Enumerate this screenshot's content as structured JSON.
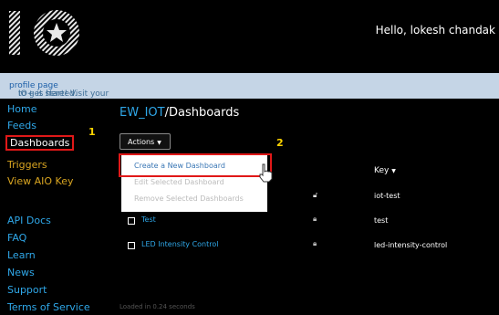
{
  "header": {
    "greeting": "Hello, lokesh chandak"
  },
  "banner": {
    "prefix": "IO+ is here! Visit your ",
    "link": "profile page",
    "suffix": " to get started."
  },
  "sidebar": {
    "items": [
      {
        "label": "Home"
      },
      {
        "label": "Feeds"
      },
      {
        "label": "Dashboards"
      },
      {
        "label": "Triggers"
      },
      {
        "label": "View AIO Key"
      },
      {
        "label": "API Docs"
      },
      {
        "label": "FAQ"
      },
      {
        "label": "Learn"
      },
      {
        "label": "News"
      },
      {
        "label": "Support"
      },
      {
        "label": "Terms of Service"
      }
    ]
  },
  "annotations": {
    "step1": "1",
    "step2": "2"
  },
  "breadcrumb": {
    "user": "EW_IOT",
    "separator": "/",
    "page": "Dashboards"
  },
  "actions": {
    "label": "Actions",
    "menu": [
      "Create a New Dashboard",
      "Edit Selected Dashboard",
      "Remove Selected Dashboards"
    ]
  },
  "table": {
    "key_header": "Key",
    "rows": [
      {
        "name": "",
        "key": "iot-test"
      },
      {
        "name": "Test",
        "key": "test"
      },
      {
        "name": "LED Intensity Control",
        "key": "led-intensity-control"
      }
    ]
  },
  "footer": {
    "loaded": "Loaded in 0.24 seconds"
  },
  "colors": {
    "link": "#2fa7e8",
    "highlight": "#e01818",
    "annotation": "#ffd400",
    "active_nav": "#d9a521"
  }
}
